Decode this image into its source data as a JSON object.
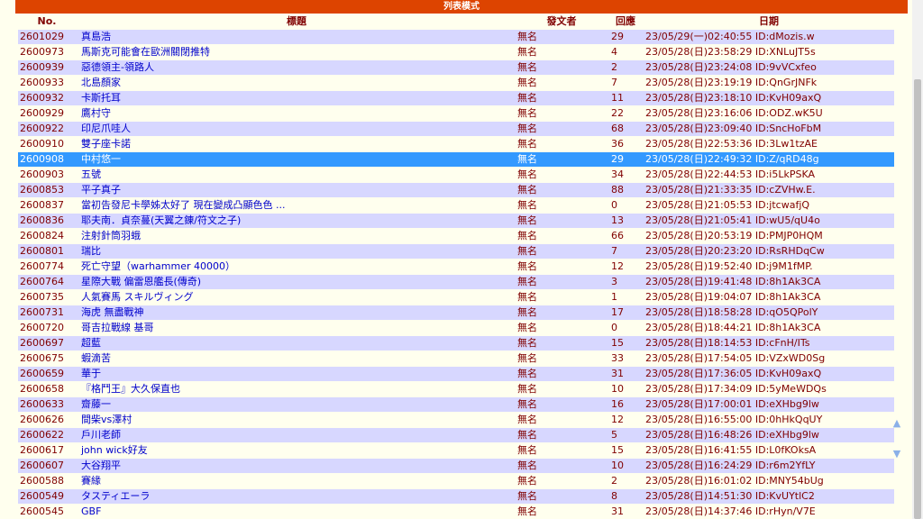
{
  "page": {
    "title": "列表模式"
  },
  "columns": {
    "no": "No.",
    "title": "標題",
    "author": "發文者",
    "replies": "回應",
    "date": "日期"
  },
  "nav": {
    "up_icon": "▲",
    "down_icon": "▼"
  },
  "rows": [
    {
      "no": "2601029",
      "title": "真島浩",
      "author": "無名",
      "replies": "29",
      "date": "23/05/29(一)02:40:55 ID:dMozis.w"
    },
    {
      "no": "2600973",
      "title": "馬斯克可能會在歐洲關閉推特",
      "author": "無名",
      "replies": "4",
      "date": "23/05/28(日)23:58:29 ID:XNLuJT5s"
    },
    {
      "no": "2600939",
      "title": "惡德領主-領路人",
      "author": "無名",
      "replies": "2",
      "date": "23/05/28(日)23:24:08 ID:9vVCxfeo"
    },
    {
      "no": "2600933",
      "title": "北島顏家",
      "author": "無名",
      "replies": "7",
      "date": "23/05/28(日)23:19:19 ID:QnGrJNFk"
    },
    {
      "no": "2600932",
      "title": "卡斯托耳",
      "author": "無名",
      "replies": "11",
      "date": "23/05/28(日)23:18:10 ID:KvH09axQ"
    },
    {
      "no": "2600929",
      "title": "鷹村守",
      "author": "無名",
      "replies": "22",
      "date": "23/05/28(日)23:16:06 ID:ODZ.wK5U"
    },
    {
      "no": "2600922",
      "title": "印尼爪哇人",
      "author": "無名",
      "replies": "68",
      "date": "23/05/28(日)23:09:40 ID:SncHoFbM"
    },
    {
      "no": "2600910",
      "title": "雙子座卡諾",
      "author": "無名",
      "replies": "36",
      "date": "23/05/28(日)22:53:36 ID:3Lw1tzAE"
    },
    {
      "no": "2600908",
      "title": "中村悠一",
      "author": "無名",
      "replies": "29",
      "date": "23/05/28(日)22:49:32 ID:Z/qRD48g",
      "selected": true
    },
    {
      "no": "2600903",
      "title": "五號",
      "author": "無名",
      "replies": "34",
      "date": "23/05/28(日)22:44:53 ID:i5LkPSKA"
    },
    {
      "no": "2600853",
      "title": "平子真子",
      "author": "無名",
      "replies": "88",
      "date": "23/05/28(日)21:33:35 ID:cZVHw.E."
    },
    {
      "no": "2600837",
      "title": "當初告發尼卡學姊太好了 現在變成凸顯色色 ...",
      "author": "無名",
      "replies": "0",
      "date": "23/05/28(日)21:05:53 ID:jtcwafjQ"
    },
    {
      "no": "2600836",
      "title": "耶夫南．貞奈蔓(天翼之錬/符文之子)",
      "author": "無名",
      "replies": "13",
      "date": "23/05/28(日)21:05:41 ID:wU5/qU4o"
    },
    {
      "no": "2600824",
      "title": "注射針筒羽蛾",
      "author": "無名",
      "replies": "66",
      "date": "23/05/28(日)20:53:19 ID:PMJP0HQM"
    },
    {
      "no": "2600801",
      "title": "瑞比",
      "author": "無名",
      "replies": "7",
      "date": "23/05/28(日)20:23:20 ID:RsRHDqCw"
    },
    {
      "no": "2600774",
      "title": "死亡守望（warhammer 40000）",
      "author": "無名",
      "replies": "12",
      "date": "23/05/28(日)19:52:40 ID:j9M1fMP."
    },
    {
      "no": "2600764",
      "title": "星際大戰 偏雷恩艦長(傳奇)",
      "author": "無名",
      "replies": "3",
      "date": "23/05/28(日)19:41:48 ID:8h1Ak3CA"
    },
    {
      "no": "2600735",
      "title": "人氣賽馬 スキルヴィング",
      "author": "無名",
      "replies": "1",
      "date": "23/05/28(日)19:04:07 ID:8h1Ak3CA"
    },
    {
      "no": "2600731",
      "title": "海虎 無盡戰神",
      "author": "無名",
      "replies": "17",
      "date": "23/05/28(日)18:58:28 ID:qO5QPolY"
    },
    {
      "no": "2600720",
      "title": "哥吉拉戰線 基哥",
      "author": "無名",
      "replies": "0",
      "date": "23/05/28(日)18:44:21 ID:8h1Ak3CA"
    },
    {
      "no": "2600697",
      "title": "超藍",
      "author": "無名",
      "replies": "15",
      "date": "23/05/28(日)18:14:53 ID:cFnH/ITs"
    },
    {
      "no": "2600675",
      "title": "蝦滴苦",
      "author": "無名",
      "replies": "33",
      "date": "23/05/28(日)17:54:05 ID:VZxWD0Sg"
    },
    {
      "no": "2600659",
      "title": "華于",
      "author": "無名",
      "replies": "31",
      "date": "23/05/28(日)17:36:05 ID:KvH09axQ"
    },
    {
      "no": "2600658",
      "title": "『格鬥王』大久保直也",
      "author": "無名",
      "replies": "10",
      "date": "23/05/28(日)17:34:09 ID:5yMeWDQs"
    },
    {
      "no": "2600633",
      "title": "齋藤一",
      "author": "無名",
      "replies": "16",
      "date": "23/05/28(日)17:00:01 ID:eXHbg9lw"
    },
    {
      "no": "2600626",
      "title": "間柴vs澤村",
      "author": "無名",
      "replies": "12",
      "date": "23/05/28(日)16:55:00 ID:0hHkQqUY"
    },
    {
      "no": "2600622",
      "title": "戶川老師",
      "author": "無名",
      "replies": "5",
      "date": "23/05/28(日)16:48:26 ID:eXHbg9lw"
    },
    {
      "no": "2600617",
      "title": "john wick好友",
      "author": "無名",
      "replies": "15",
      "date": "23/05/28(日)16:41:55 ID:L0fKOksA"
    },
    {
      "no": "2600607",
      "title": "大谷翔平",
      "author": "無名",
      "replies": "10",
      "date": "23/05/28(日)16:24:29 ID:r6m2YfLY"
    },
    {
      "no": "2600588",
      "title": "賽緣",
      "author": "無名",
      "replies": "2",
      "date": "23/05/28(日)16:01:02 ID:MNY54bUg"
    },
    {
      "no": "2600549",
      "title": "タスティエーラ",
      "author": "無名",
      "replies": "8",
      "date": "23/05/28(日)14:51:30 ID:KvUYtlC2"
    },
    {
      "no": "2600545",
      "title": "GBF",
      "author": "無名",
      "replies": "31",
      "date": "23/05/28(日)14:37:46 ID:rHyn/V7E"
    }
  ]
}
